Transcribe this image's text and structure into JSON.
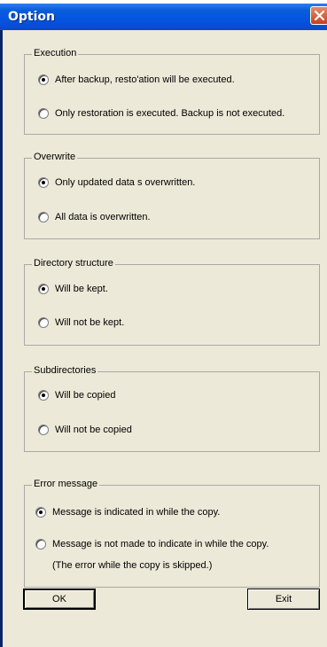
{
  "window": {
    "title": "Option"
  },
  "groups": {
    "execution": {
      "title": "Execution",
      "options": [
        {
          "label": "After backup, resto'ation will be executed.",
          "selected": true
        },
        {
          "label": "Only restoration is executed. Backup is not executed.",
          "selected": false
        }
      ]
    },
    "overwrite": {
      "title": "Overwrite",
      "options": [
        {
          "label": "Only updated data s overwritten.",
          "selected": true
        },
        {
          "label": "All data is overwritten.",
          "selected": false
        }
      ]
    },
    "directory": {
      "title": "Directory structure",
      "options": [
        {
          "label": "Will be kept.",
          "selected": true
        },
        {
          "label": "Will not be kept.",
          "selected": false
        }
      ]
    },
    "subdirectories": {
      "title": "Subdirectories",
      "options": [
        {
          "label": "Will be copied",
          "selected": true
        },
        {
          "label": "Will not be copied",
          "selected": false
        }
      ]
    },
    "error": {
      "title": "Error message",
      "options": [
        {
          "label": "Message is indicated in while the copy.",
          "selected": true
        },
        {
          "label": "Message is not made to indicate in while the copy.",
          "selected": false
        }
      ],
      "note": "(The error while the copy is skipped.)"
    }
  },
  "buttons": {
    "ok": "OK",
    "exit": "Exit"
  },
  "icons": {
    "close": "close-icon"
  },
  "colors": {
    "titlebar": "#0454e2",
    "dialog": "#ece9d8",
    "close": "#c8401c"
  }
}
